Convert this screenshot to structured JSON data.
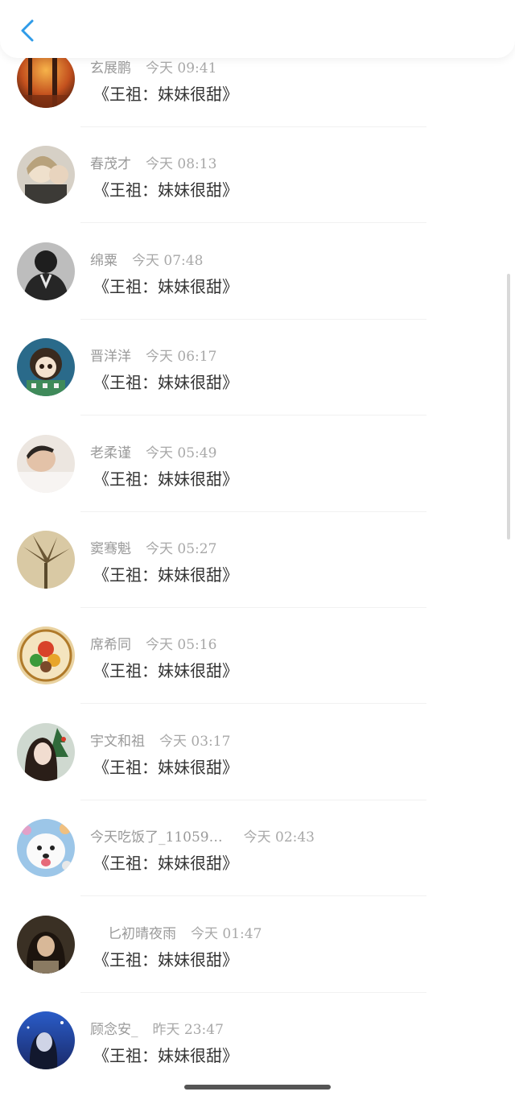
{
  "header": {
    "back_icon": "chevron-left-icon",
    "accent": "#2f9be8"
  },
  "messages": [
    {
      "name": "玄展鹏",
      "time": "今天 09:41",
      "text": "《王祖：妹妹很甜》",
      "avatar": "autumn-forest-photo"
    },
    {
      "name": "春茂才",
      "time": "今天 08:13",
      "text": "《王祖：妹妹很甜》",
      "avatar": "anime-couple-illustration"
    },
    {
      "name": "绵粟",
      "time": "今天 07:48",
      "text": "《王祖：妹妹很甜》",
      "avatar": "masked-boy-photo"
    },
    {
      "name": "晋洋洋",
      "time": "今天 06:17",
      "text": "《王祖：妹妹很甜》",
      "avatar": "cartoon-girl-illustration"
    },
    {
      "name": "老柔谨",
      "time": "今天 05:49",
      "text": "《王祖：妹妹很甜》",
      "avatar": "sleeping-man-photo"
    },
    {
      "name": "窦骞魁",
      "time": "今天 05:27",
      "text": "《王祖：妹妹很甜》",
      "avatar": "dried-flower-photo"
    },
    {
      "name": "席希同",
      "time": "今天 05:16",
      "text": "《王祖：妹妹很甜》",
      "avatar": "fruit-medallion-image"
    },
    {
      "name": "宇文和祖",
      "time": "今天 03:17",
      "text": "《王祖：妹妹很甜》",
      "avatar": "girl-christmas-photo"
    },
    {
      "name": "今天吃饭了_11059…",
      "time": "今天 02:43",
      "text": "《王祖：妹妹很甜》",
      "avatar": "white-dog-photo"
    },
    {
      "name": "匕初晴夜雨",
      "time": "今天 01:47",
      "text": "《王祖：妹妹很甜》",
      "avatar": "girl-dark-photo"
    },
    {
      "name": "顾念安_",
      "time": "昨天 23:47",
      "text": "《王祖：妹妹很甜》",
      "avatar": "boy-blue-sky-photo"
    }
  ]
}
